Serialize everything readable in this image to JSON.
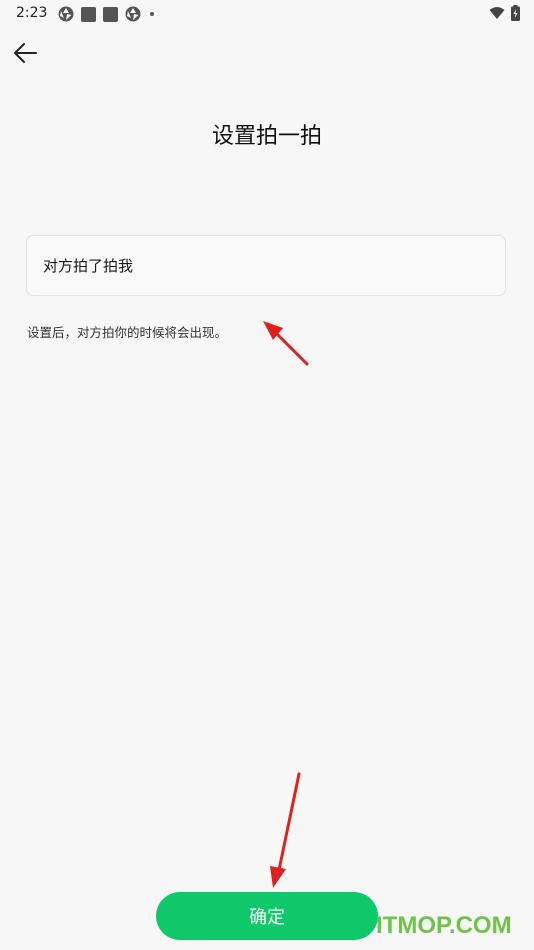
{
  "status_bar": {
    "time": "2:23",
    "left_icons": [
      "aperture-icon",
      "square-notification-icon",
      "square-notification-icon",
      "aperture-icon",
      "dot-icon"
    ],
    "right_icons": [
      "wifi-icon",
      "battery-charging-icon"
    ]
  },
  "header": {
    "back_icon": "arrow-left-icon",
    "title": "设置拍一拍"
  },
  "form": {
    "input_value": "对方拍了拍我",
    "hint": "设置后，对方拍你的时候将会出现。"
  },
  "footer": {
    "confirm_label": "确定"
  },
  "watermark": "ITMOP.COM",
  "colors": {
    "background": "#f7f7f7",
    "accent": "#0fc86a",
    "annotation_arrow": "#e0201f"
  }
}
